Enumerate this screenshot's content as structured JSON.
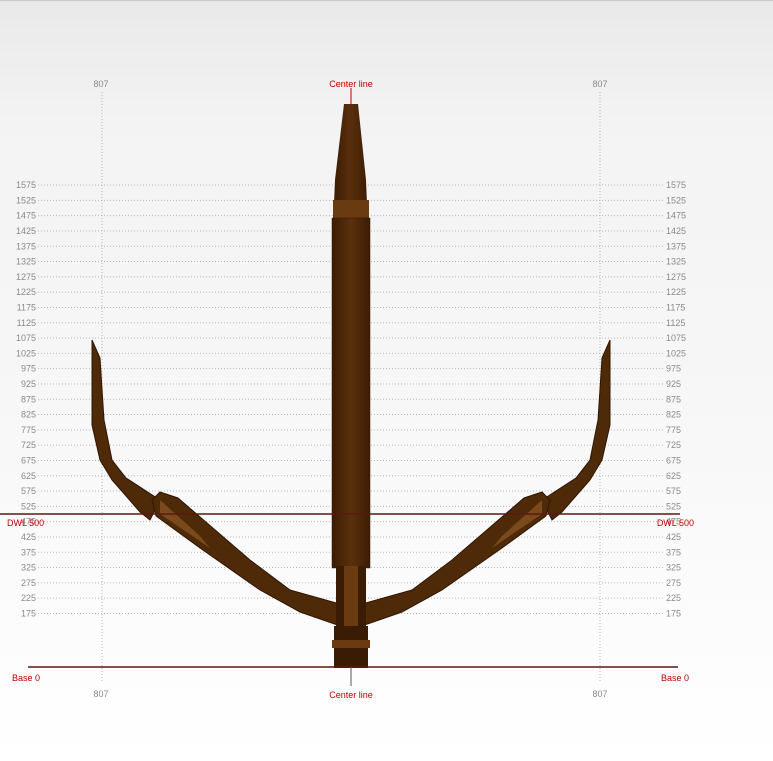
{
  "labels": {
    "center_line_top": "Center line",
    "center_line_bottom": "Center line",
    "dwl_left": "DWL 500",
    "dwl_right": "DWL 500",
    "base_left": "Base 0",
    "base_right": "Base 0",
    "offset_top_left": "807",
    "offset_top_right": "807",
    "offset_bottom_left": "807",
    "offset_bottom_right": "807"
  },
  "waterlines": [
    "1575",
    "1525",
    "1475",
    "1425",
    "1375",
    "1325",
    "1275",
    "1225",
    "1175",
    "1125",
    "1075",
    "1025",
    "975",
    "925",
    "875",
    "825",
    "775",
    "725",
    "675",
    "625",
    "575",
    "525",
    "475",
    "425",
    "375",
    "325",
    "275",
    "225",
    "175"
  ],
  "dwl_value": 500,
  "base_value": 0,
  "colors": {
    "hull": "#4e2a08",
    "hull_dark": "#2f1704",
    "hull_light": "#7a4a1c",
    "waterline": "#5a1a10",
    "accent": "#c00000"
  }
}
